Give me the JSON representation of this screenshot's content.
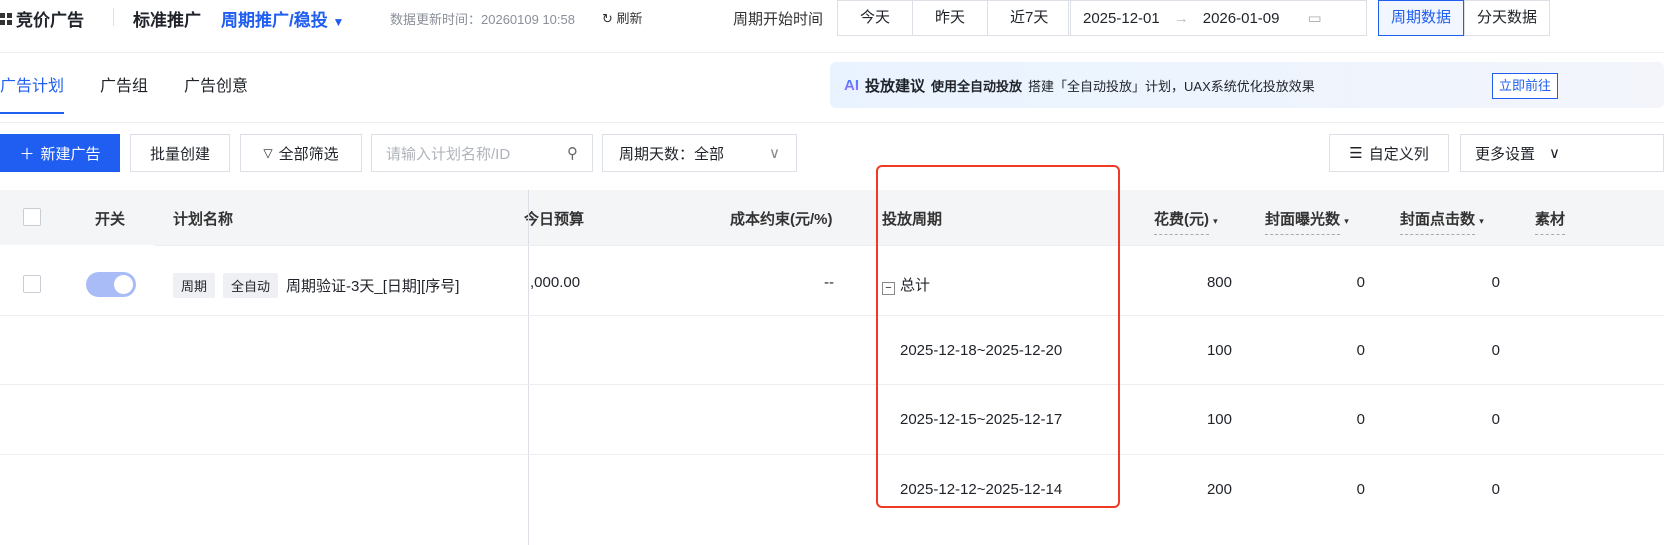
{
  "header": {
    "brand": "竞价广告",
    "standard": "标准推广",
    "cycle": "周期推广/稳投",
    "update_time": "数据更新时间：20260109 10:58",
    "refresh": "刷新",
    "start_label": "周期开始时间",
    "quick": [
      "今天",
      "昨天",
      "近7天"
    ],
    "date_start": "2025-12-01",
    "date_end": "2026-01-09",
    "views": [
      "周期数据",
      "分天数据"
    ]
  },
  "tabs": [
    "广告计划",
    "广告组",
    "广告创意"
  ],
  "banner": {
    "ai": "AI",
    "title": "投放建议",
    "bold": "使用全自动投放",
    "text": "搭建「全自动投放」计划，UAX系统优化投放效果",
    "go": "立即前往"
  },
  "toolbar": {
    "new": "新建广告",
    "batch": "批量创建",
    "filter": "全部筛选",
    "search_placeholder": "请输入计划名称/ID",
    "days": "周期天数：全部",
    "custom": "自定义列",
    "more": "更多设置"
  },
  "table": {
    "headers": {
      "switch": "开关",
      "name": "计划名称",
      "budget": "今日预算",
      "cost": "成本约束(元/%)",
      "period": "投放周期",
      "spend": "花费(元)",
      "impr": "封面曝光数",
      "click": "封面点击数",
      "material": "素材"
    },
    "plan": {
      "tags": [
        "周期",
        "全自动"
      ],
      "name": "周期验证-3天_[日期][序号]",
      "budget": ",000.00",
      "cost": "--",
      "enabled": true
    },
    "rows": [
      {
        "period": "总计",
        "spend": "800",
        "impr": "0",
        "click": "0"
      },
      {
        "period": "2025-12-18~2025-12-20",
        "spend": "100",
        "impr": "0",
        "click": "0"
      },
      {
        "period": "2025-12-15~2025-12-17",
        "spend": "100",
        "impr": "0",
        "click": "0"
      },
      {
        "period": "2025-12-12~2025-12-14",
        "spend": "200",
        "impr": "0",
        "click": "0"
      }
    ]
  }
}
